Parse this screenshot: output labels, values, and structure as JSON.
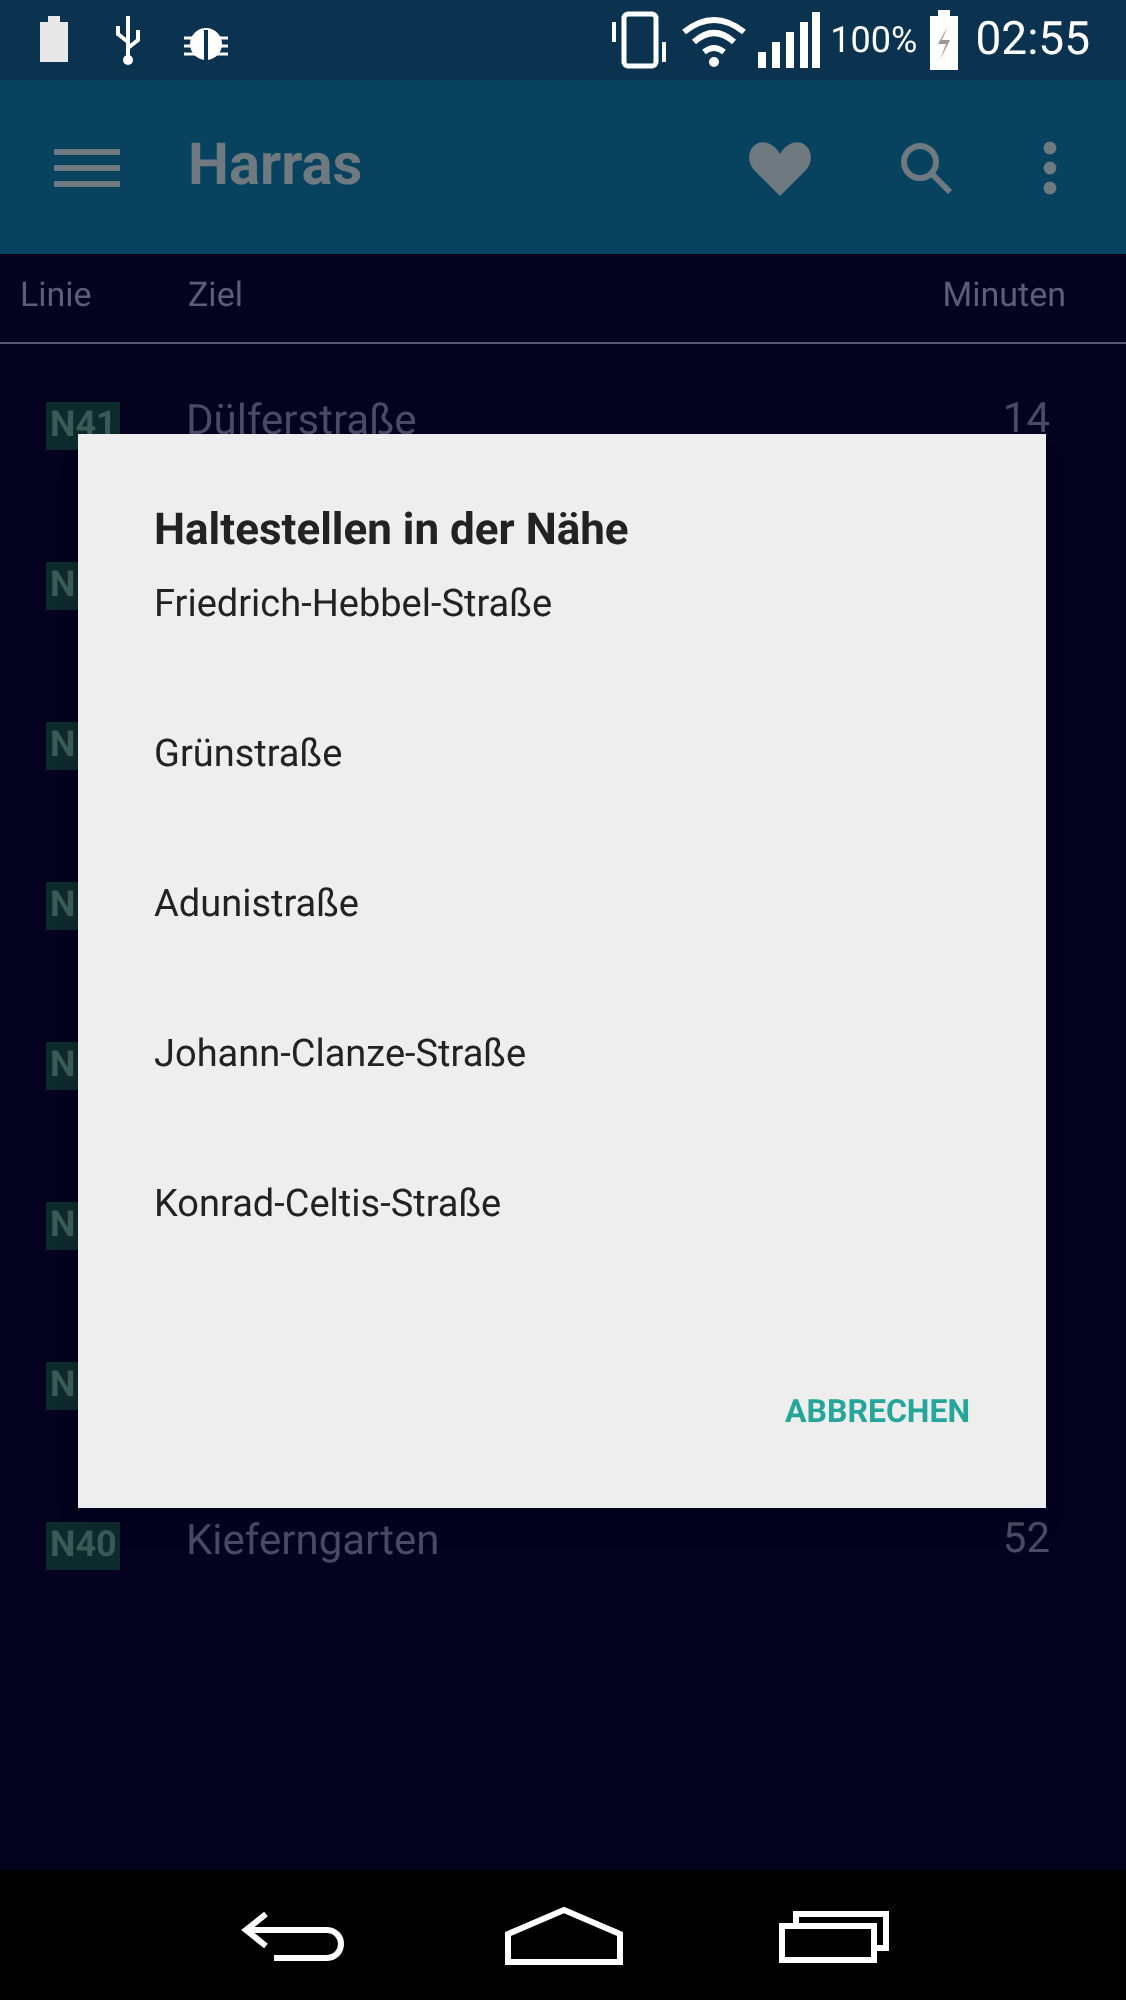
{
  "status_bar": {
    "battery_percent": "100%",
    "time": "02:55"
  },
  "toolbar": {
    "title": "Harras"
  },
  "table": {
    "columns": [
      "Linie",
      "Ziel",
      "Minuten"
    ],
    "rows": [
      {
        "line": "N41",
        "destination": "Dülferstraße",
        "minutes": "14"
      },
      {
        "line": "N"
      },
      {
        "line": "N"
      },
      {
        "line": "N"
      },
      {
        "line": "N"
      },
      {
        "line": "N"
      },
      {
        "line": "N"
      },
      {
        "line": "N40",
        "destination": "Kieferngarten",
        "minutes": "52"
      }
    ]
  },
  "dialog": {
    "title": "Haltestellen in der Nähe",
    "items": [
      "Friedrich-Hebbel-Straße",
      "Grünstraße",
      "Adunistraße",
      "Johann-Clanze-Straße",
      "Konrad-Celtis-Straße"
    ],
    "buttons": [
      "ABBRECHEN"
    ]
  }
}
